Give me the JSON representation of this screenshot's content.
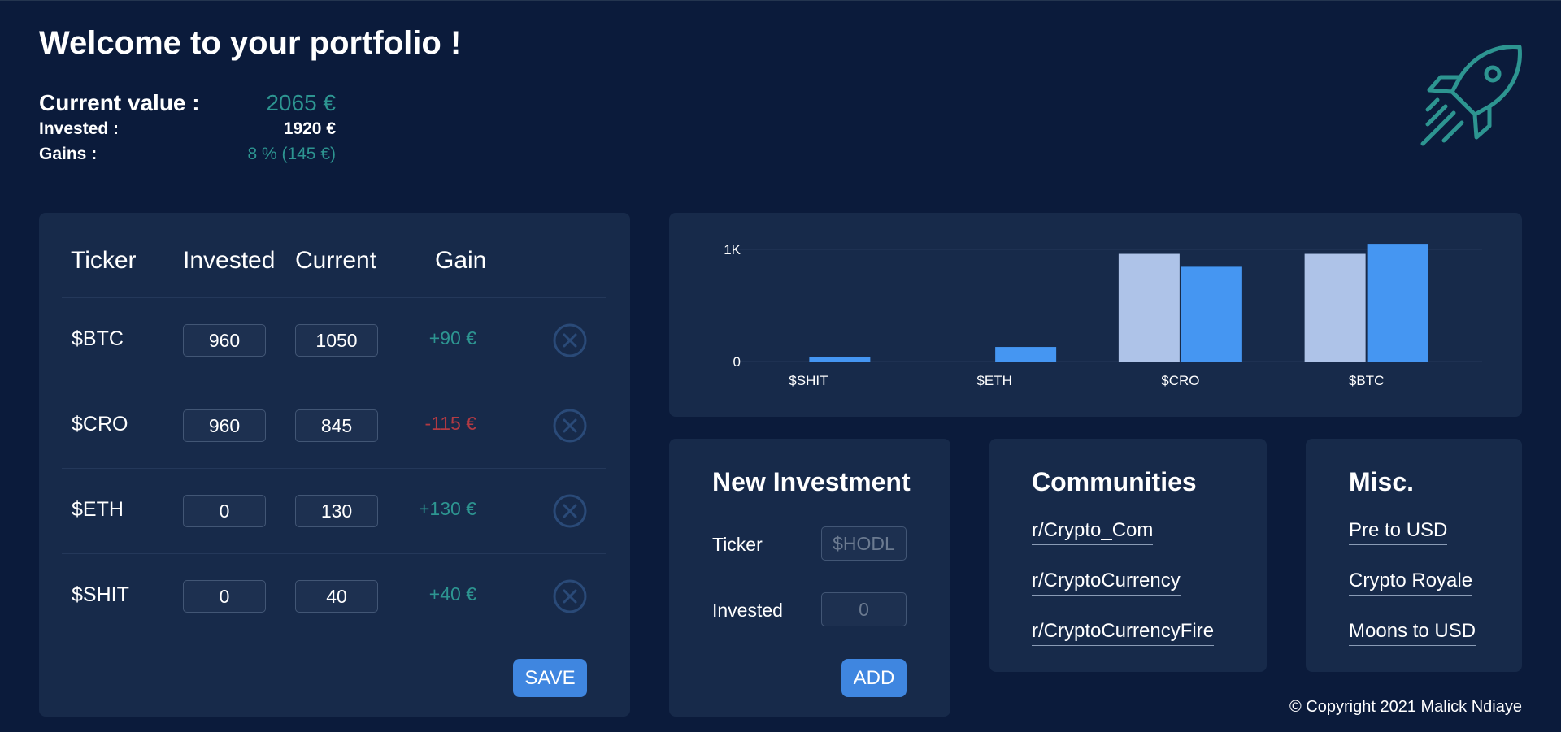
{
  "header": {
    "title": "Welcome to your portfolio !"
  },
  "summary": {
    "current_label": "Current value :",
    "current_value": "2065 €",
    "invested_label": "Invested :",
    "invested_value": "1920 €",
    "gains_label": "Gains :",
    "gains_value": "8 % (145 €)"
  },
  "holdings": {
    "columns": [
      "Ticker",
      "Invested",
      "Current",
      "Gain"
    ],
    "rows": [
      {
        "ticker": "$BTC",
        "invested": "960",
        "current": "1050",
        "gain": "+90 €"
      },
      {
        "ticker": "$CRO",
        "invested": "960",
        "current": "845",
        "gain": "-115 €"
      },
      {
        "ticker": "$ETH",
        "invested": "0",
        "current": "130",
        "gain": "+130 €"
      },
      {
        "ticker": "$SHIT",
        "invested": "0",
        "current": "40",
        "gain": "+40 €"
      }
    ],
    "save_label": "SAVE",
    "remove_icon": "close-circle-icon"
  },
  "chart_data": {
    "type": "bar",
    "categories": [
      "$SHIT",
      "$ETH",
      "$CRO",
      "$BTC"
    ],
    "series": [
      {
        "values": [
          0,
          0,
          960,
          960
        ],
        "color": "#aec3e8"
      },
      {
        "values": [
          40,
          130,
          845,
          1050
        ],
        "color": "#4596f2"
      }
    ],
    "yticks": [
      "0",
      "1K"
    ],
    "ylim": [
      0,
      1000
    ],
    "grid": true
  },
  "new_investment": {
    "title": "New Investment",
    "ticker_label": "Ticker",
    "ticker_placeholder": "$HODL",
    "invested_label": "Invested",
    "invested_placeholder": "0",
    "add_label": "ADD"
  },
  "communities": {
    "title": "Communities",
    "links": [
      "r/Crypto_Com",
      "r/CryptoCurrency",
      "r/CryptoCurrencyFire"
    ]
  },
  "misc": {
    "title": "Misc.",
    "links": [
      "Pre to USD",
      "Crypto Royale",
      "Moons to USD"
    ]
  },
  "footer": {
    "copyright": "© Copyright 2021 Malick Ndiaye"
  },
  "colors": {
    "background": "#0b1b3b",
    "panel": "#172a4a",
    "accent_teal": "#2d9591",
    "negative": "#b23a43",
    "button": "#3f86e0"
  },
  "icons": {
    "logo": "rocket-icon"
  }
}
